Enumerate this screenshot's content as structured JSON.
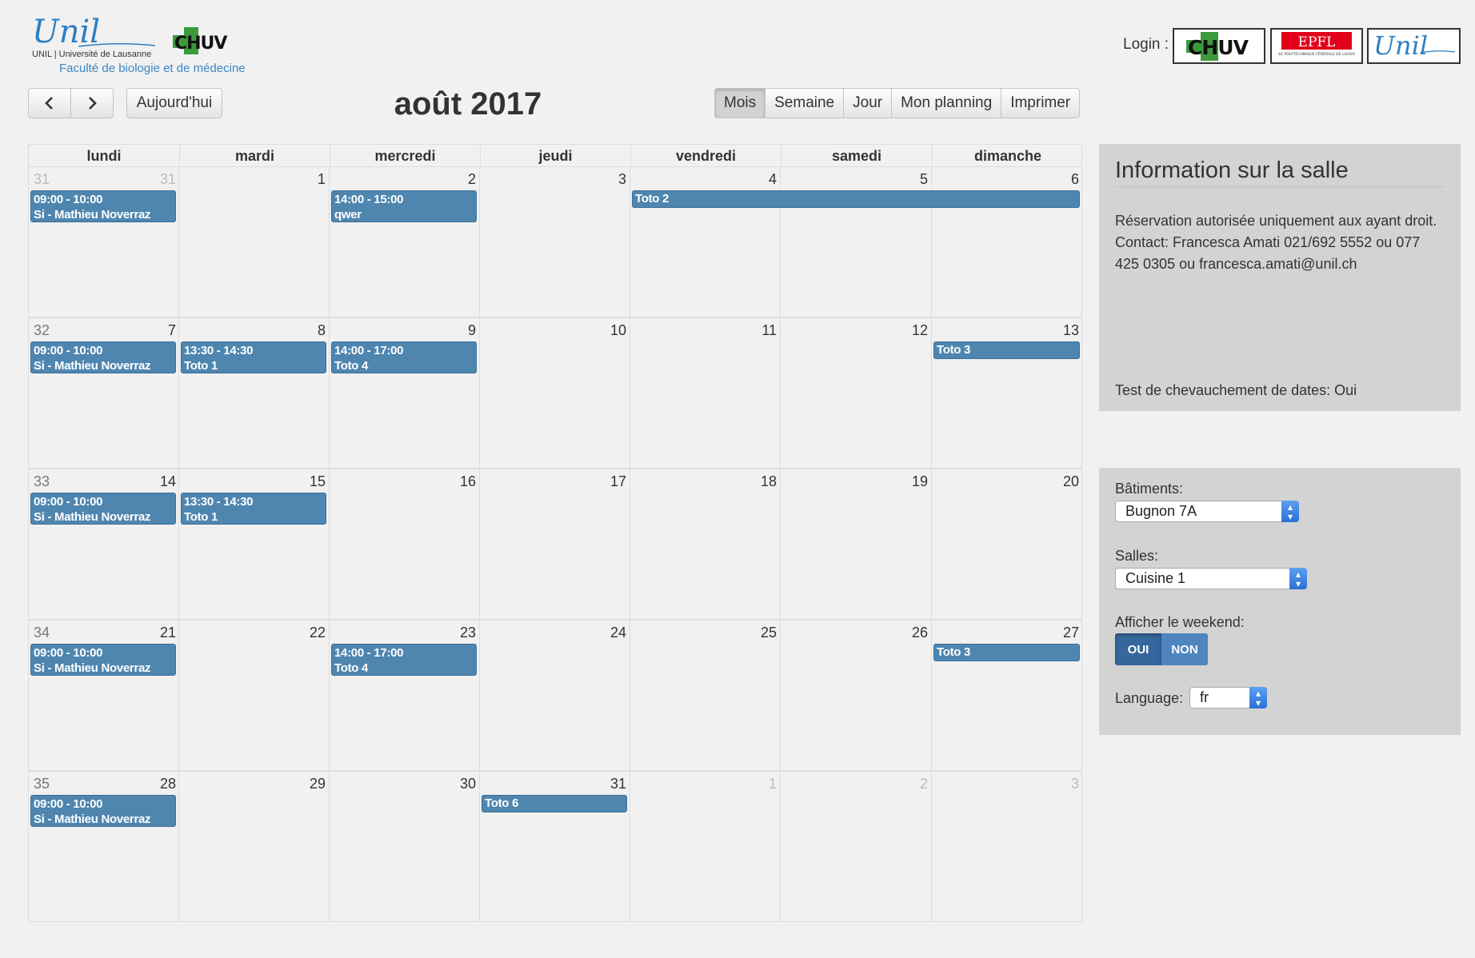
{
  "header": {
    "unil_logo_script": "Unil",
    "unil_logo_subtitle": "UNIL | Université de Lausanne",
    "chuv_logo_text": "CHUV",
    "faculty": "Faculté de biologie et de médecine",
    "login_label": "Login :",
    "login_options": [
      {
        "text": "CHUV"
      },
      {
        "text": "EPFL",
        "subtitle": "ÉCOLE POLYTECHNIQUE FÉDÉRALE DE LAUSANNE"
      },
      {
        "text": "Unil"
      }
    ]
  },
  "toolbar": {
    "prev_icon": "chevron-left-icon",
    "next_icon": "chevron-right-icon",
    "today_label": "Aujourd'hui",
    "title": "août 2017",
    "views": [
      {
        "label": "Mois",
        "active": true
      },
      {
        "label": "Semaine",
        "active": false
      },
      {
        "label": "Jour",
        "active": false
      },
      {
        "label": "Mon planning",
        "active": false
      },
      {
        "label": "Imprimer",
        "active": false
      }
    ]
  },
  "calendar": {
    "weekdays": [
      "lundi",
      "mardi",
      "mercredi",
      "jeudi",
      "vendredi",
      "samedi",
      "dimanche"
    ],
    "weeks": [
      {
        "week_number": "31",
        "week_number_other": true,
        "days": [
          {
            "num": "31",
            "other": true
          },
          {
            "num": "1"
          },
          {
            "num": "2"
          },
          {
            "num": "3"
          },
          {
            "num": "4"
          },
          {
            "num": "5"
          },
          {
            "num": "6"
          }
        ]
      },
      {
        "week_number": "32",
        "week_number_other": false,
        "days": [
          {
            "num": "7"
          },
          {
            "num": "8"
          },
          {
            "num": "9"
          },
          {
            "num": "10"
          },
          {
            "num": "11"
          },
          {
            "num": "12"
          },
          {
            "num": "13"
          }
        ]
      },
      {
        "week_number": "33",
        "week_number_other": false,
        "days": [
          {
            "num": "14"
          },
          {
            "num": "15"
          },
          {
            "num": "16"
          },
          {
            "num": "17"
          },
          {
            "num": "18"
          },
          {
            "num": "19"
          },
          {
            "num": "20"
          }
        ]
      },
      {
        "week_number": "34",
        "week_number_other": false,
        "days": [
          {
            "num": "21"
          },
          {
            "num": "22"
          },
          {
            "num": "23"
          },
          {
            "num": "24"
          },
          {
            "num": "25"
          },
          {
            "num": "26"
          },
          {
            "num": "27"
          }
        ]
      },
      {
        "week_number": "35",
        "week_number_other": false,
        "days": [
          {
            "num": "28"
          },
          {
            "num": "29"
          },
          {
            "num": "30"
          },
          {
            "num": "31"
          },
          {
            "num": "1",
            "other": true
          },
          {
            "num": "2",
            "other": true
          },
          {
            "num": "3",
            "other": true
          }
        ]
      }
    ],
    "events": [
      {
        "week": 0,
        "day": 0,
        "span": 1,
        "time": "09:00 - 10:00",
        "title": "Si - Mathieu Noverraz"
      },
      {
        "week": 0,
        "day": 2,
        "span": 1,
        "time": "14:00 - 15:00",
        "title": "qwer"
      },
      {
        "week": 0,
        "day": 4,
        "span": 3,
        "time": "",
        "title": "Toto 2"
      },
      {
        "week": 1,
        "day": 0,
        "span": 1,
        "time": "09:00 - 10:00",
        "title": "Si - Mathieu Noverraz"
      },
      {
        "week": 1,
        "day": 1,
        "span": 1,
        "time": "13:30 - 14:30",
        "title": "Toto 1"
      },
      {
        "week": 1,
        "day": 2,
        "span": 1,
        "time": "14:00 - 17:00",
        "title": "Toto 4"
      },
      {
        "week": 1,
        "day": 6,
        "span": 1,
        "time": "",
        "title": "Toto 3"
      },
      {
        "week": 2,
        "day": 0,
        "span": 1,
        "time": "09:00 - 10:00",
        "title": "Si - Mathieu Noverraz"
      },
      {
        "week": 2,
        "day": 1,
        "span": 1,
        "time": "13:30 - 14:30",
        "title": "Toto 1"
      },
      {
        "week": 3,
        "day": 0,
        "span": 1,
        "time": "09:00 - 10:00",
        "title": "Si - Mathieu Noverraz"
      },
      {
        "week": 3,
        "day": 2,
        "span": 1,
        "time": "14:00 - 17:00",
        "title": "Toto 4"
      },
      {
        "week": 3,
        "day": 6,
        "span": 1,
        "time": "",
        "title": "Toto 3"
      },
      {
        "week": 4,
        "day": 0,
        "span": 1,
        "time": "09:00 - 10:00",
        "title": "Si - Mathieu Noverraz"
      },
      {
        "week": 4,
        "day": 3,
        "span": 1,
        "time": "",
        "title": "Toto 6"
      }
    ],
    "event_color": "#4f86b0"
  },
  "info": {
    "title": "Information sur la salle",
    "line1": "Réservation autorisée uniquement aux ayant droit.",
    "line2": "Contact: Francesca Amati 021/692 5552 ou 077 425 0305 ou francesca.amati@unil.ch",
    "overlap": "Test de chevauchement de dates: Oui"
  },
  "filters": {
    "buildings_label": "Bâtiments:",
    "buildings_value": "Bugnon 7A",
    "rooms_label": "Salles:",
    "rooms_value": "Cuisine 1",
    "weekend_label": "Afficher le weekend:",
    "weekend_on": "OUI",
    "weekend_off": "NON",
    "weekend_selected": "OUI",
    "language_label": "Language:",
    "language_value": "fr"
  }
}
